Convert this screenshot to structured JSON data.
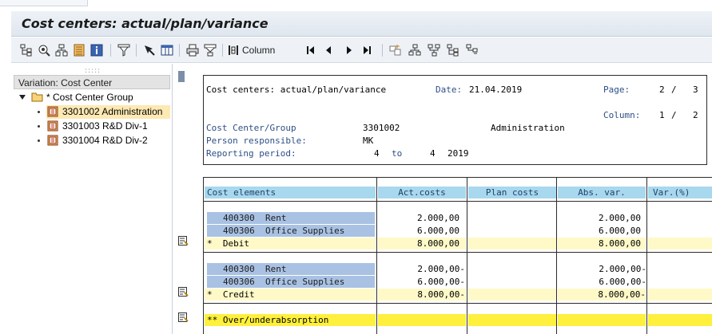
{
  "window": {
    "title": "Cost centers: actual/plan/variance"
  },
  "toolbar": {
    "column_label": "Column",
    "icons": [
      "hierarchy-icon",
      "find-icon",
      "structure-icon",
      "list-icon",
      "info-icon",
      "filter-icon",
      "select-icon",
      "columns-icon",
      "print-icon",
      "download-icon",
      "column-settings-icon",
      "first-page-icon",
      "previous-page-icon",
      "next-page-icon",
      "last-page-icon",
      "expand-icon",
      "hierarchy-up-icon",
      "hierarchy-down-icon",
      "node-expand-icon",
      "node-collapse-icon"
    ]
  },
  "tree": {
    "header": "Variation: Cost Center",
    "group_label": "* Cost Center Group",
    "items": [
      {
        "label": "3301002 Administration",
        "selected": true
      },
      {
        "label": "3301003 R&D Div-1",
        "selected": false
      },
      {
        "label": "3301004 R&D Div-2",
        "selected": false
      }
    ]
  },
  "report": {
    "heading": "Cost centers: actual/plan/variance",
    "date_label": "Date:",
    "date_value": "21.04.2019",
    "page_label": "Page:",
    "page_current": "2",
    "page_sep": "/",
    "page_total": "3",
    "column_label": "Column:",
    "column_current": "1",
    "column_sep": "/",
    "column_total": "2",
    "cc_label": "Cost Center/Group",
    "cc_value": "3301002",
    "cc_name": "Administration",
    "person_label": "Person responsible:",
    "person_value": "MK",
    "period_label": "Reporting period:",
    "period_from": "4",
    "period_to_word": "to",
    "period_to": "4",
    "period_year": "2019"
  },
  "table": {
    "headers": [
      "Cost elements",
      "Act.costs",
      "Plan costs",
      "Abs. var.",
      "Var.(%)"
    ],
    "debit_rows": [
      {
        "code": "400300",
        "name": "Rent",
        "act": "2.000,00",
        "plan": "",
        "abs": "2.000,00",
        "pct": ""
      },
      {
        "code": "400306",
        "name": "Office Supplies",
        "act": "6.000,00",
        "plan": "",
        "abs": "6.000,00",
        "pct": ""
      }
    ],
    "debit_total": {
      "mark": "*",
      "label": "Debit",
      "act": "8.000,00",
      "plan": "",
      "abs": "8.000,00",
      "pct": ""
    },
    "credit_rows": [
      {
        "code": "400300",
        "name": "Rent",
        "act": "2.000,00-",
        "plan": "",
        "abs": "2.000,00-",
        "pct": ""
      },
      {
        "code": "400306",
        "name": "Office Supplies",
        "act": "6.000,00-",
        "plan": "",
        "abs": "6.000,00-",
        "pct": ""
      }
    ],
    "credit_total": {
      "mark": "*",
      "label": "Credit",
      "act": "8.000,00-",
      "plan": "",
      "abs": "8.000,00-",
      "pct": ""
    },
    "grand_total": {
      "mark": "**",
      "label": "Over/underabsorption",
      "act": "",
      "plan": "",
      "abs": "",
      "pct": ""
    }
  },
  "colors": {
    "column_header_bg": "#a8d8ee",
    "key_cell_bg": "#a9c2e4",
    "subtotal_bg": "#fff9c8",
    "total_bg": "#fef03c",
    "selected_node_bg": "#fde9b3"
  }
}
